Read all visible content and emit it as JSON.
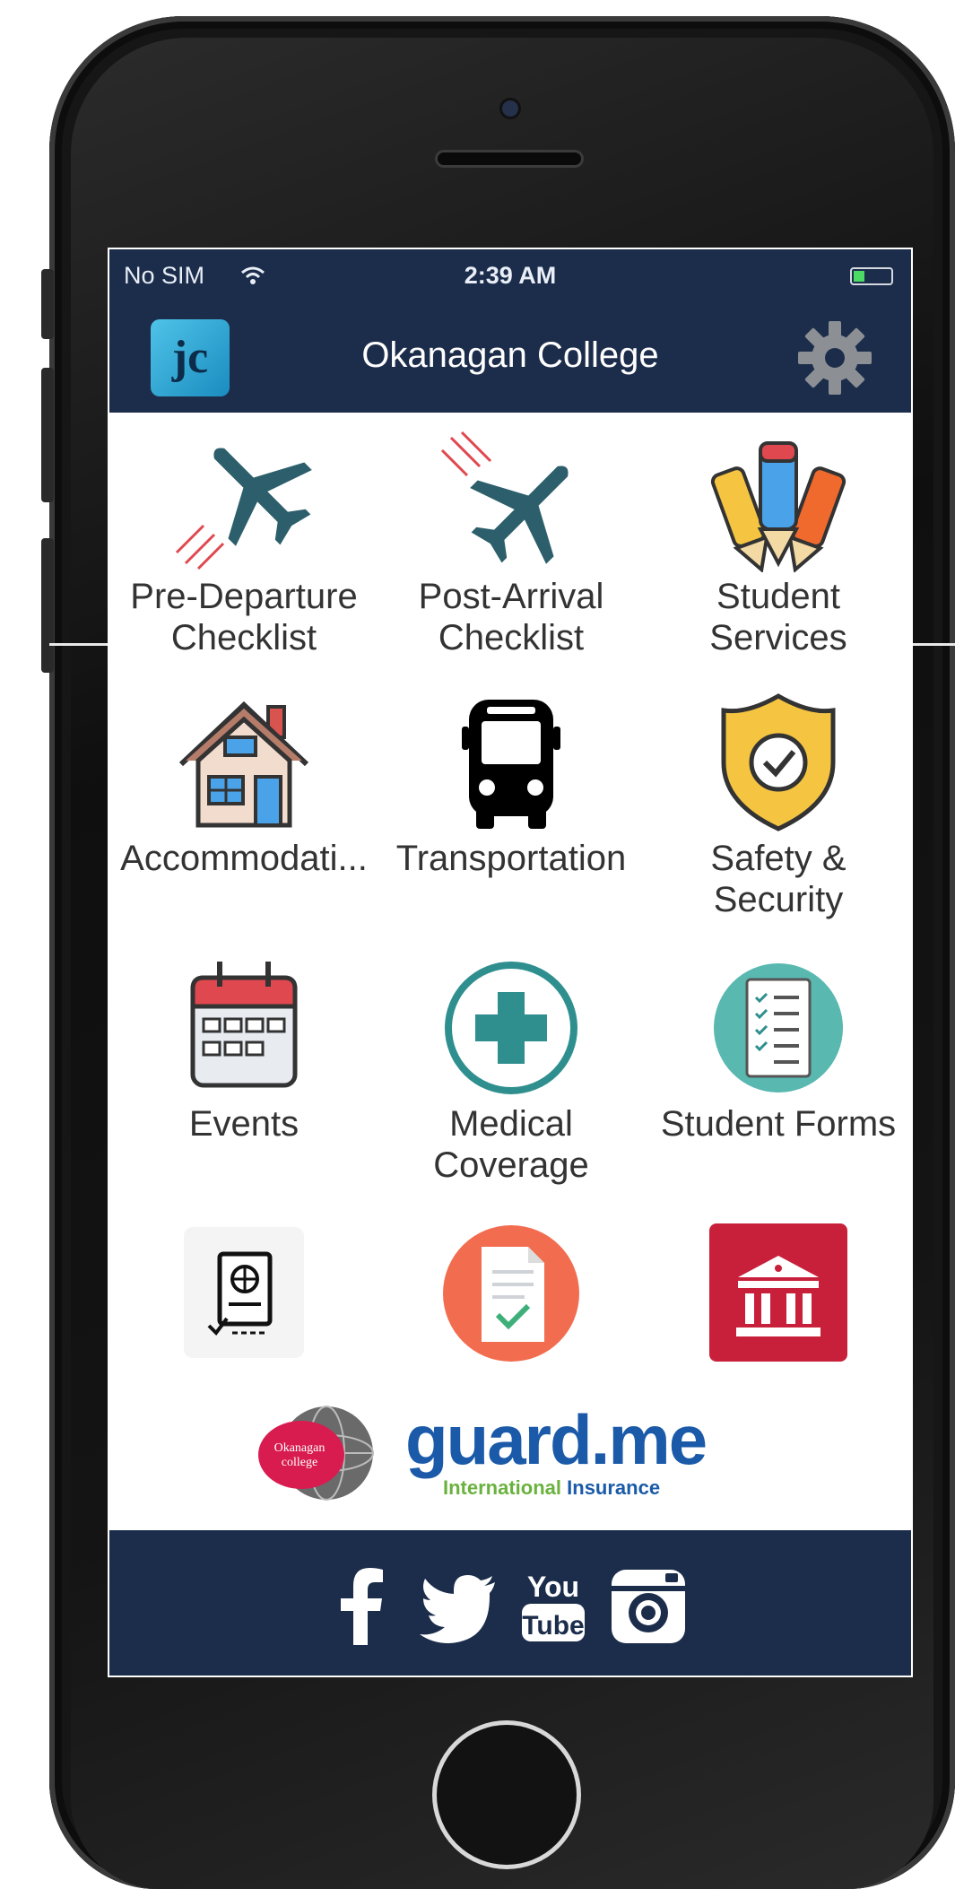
{
  "status_bar": {
    "carrier": "No SIM",
    "time": "2:39 AM"
  },
  "header": {
    "app_logo_text": "jc",
    "title": "Okanagan College"
  },
  "grid": {
    "items": [
      {
        "label": "Pre-Departure\nChecklist",
        "icon": "airplane-takeoff-icon"
      },
      {
        "label": "Post-Arrival\nChecklist",
        "icon": "airplane-landing-icon"
      },
      {
        "label": "Student\nServices",
        "icon": "pencils-icon"
      },
      {
        "label": "Accommodati...",
        "icon": "house-icon"
      },
      {
        "label": "Transportation",
        "icon": "bus-icon"
      },
      {
        "label": "Safety &\nSecurity",
        "icon": "shield-check-icon"
      },
      {
        "label": "Events",
        "icon": "calendar-icon"
      },
      {
        "label": "Medical\nCoverage",
        "icon": "medical-cross-icon"
      },
      {
        "label": "Student Forms",
        "icon": "checklist-icon"
      },
      {
        "label": "",
        "icon": "passport-icon"
      },
      {
        "label": "",
        "icon": "document-check-icon"
      },
      {
        "label": "",
        "icon": "bank-icon"
      }
    ]
  },
  "partners": {
    "college_seal_text": "Okanagan College",
    "insurer_name": "guard.me",
    "insurer_tagline_1": "International",
    "insurer_tagline_2": "Insurance"
  },
  "footer": {
    "social": [
      "facebook-icon",
      "twitter-icon",
      "youtube-icon",
      "instagram-icon"
    ],
    "youtube_text_top": "You",
    "youtube_text_bottom": "Tube"
  },
  "colors": {
    "navy": "#1c2d4b",
    "teal": "#2f8f8f",
    "airplane": "#2c5f6b",
    "red": "#c8203a"
  }
}
